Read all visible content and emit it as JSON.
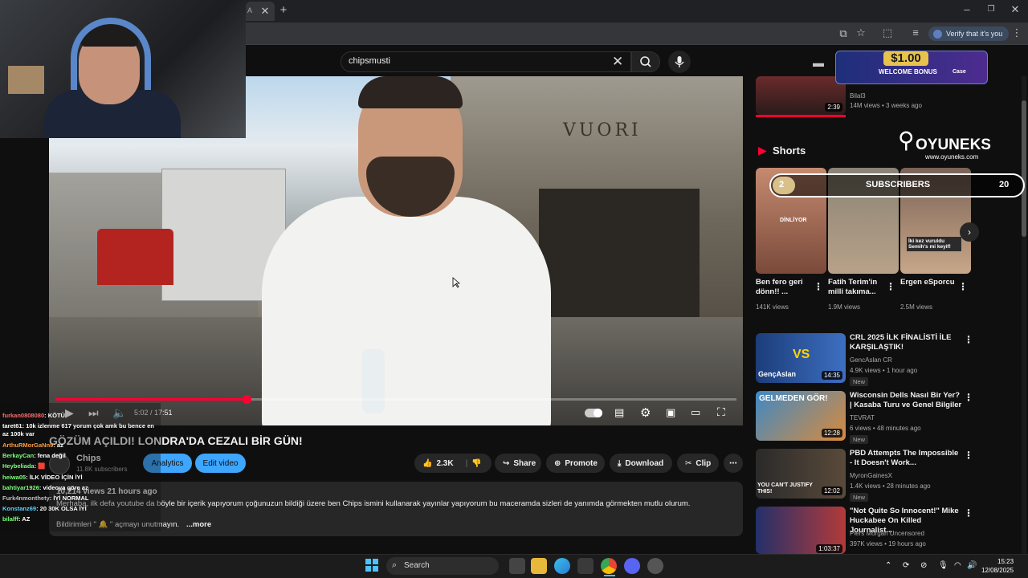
{
  "browser": {
    "tab_partial_title": "A",
    "verify_label": "Verify that it's you"
  },
  "search": {
    "query": "chipsmusti"
  },
  "player": {
    "time_current": "5:02",
    "time_total": "17:51",
    "time_display": "5:02 / 17:51",
    "progress_fraction": 0.281,
    "store_sign": "VUORI"
  },
  "video": {
    "title": "GÖZÜM AÇILDI! LONDRA'DA CEZALI BİR GÜN!",
    "channel_name": "Chips",
    "channel_subs": "11.8K subscribers",
    "analytics_label": "Analytics",
    "edit_label": "Edit video",
    "likes": "2.3K",
    "share_label": "Share",
    "promote_label": "Promote",
    "download_label": "Download",
    "clip_label": "Clip",
    "views_time": "10,214 views  21 hours ago",
    "description": "Merhaba, ilk defa youtube da böyle bir içerik yapıyorum çoğunuzun bildiği üzere ben Chips ismini kullanarak yayınlar yapıyorum bu maceramda sizleri de yanımda görmekten mutlu olurum.",
    "notif_text": "Bildirimleri \" 🔔 \" açmayı unutmayın.",
    "more_label": "...more"
  },
  "chat": [
    {
      "user": "furkan0808080",
      "msg": ": KÖTÜ",
      "color": "#ff6b6b"
    },
    {
      "user": "taret61",
      "msg": ": 10k izlenme 617 yorum çok amk bu bence en az 100k var",
      "color": "#ffffff"
    },
    {
      "user": "ArthuRMorGaNn9",
      "msg": ": az",
      "color": "#ff9a3c"
    },
    {
      "user": "BerkayCan",
      "msg": ": fena değil",
      "color": "#7cff7c"
    },
    {
      "user": "Heybeliada",
      "msg": ": 🟥",
      "color": "#7cff7c"
    },
    {
      "user": "heiwa05",
      "msg": ": İLK VİDEO İÇİN İYİ",
      "color": "#7cff7c"
    },
    {
      "user": "bahtiyar1926",
      "msg": ": videoya göre az",
      "color": "#7cff7c"
    },
    {
      "user": "Furk4nmonthety",
      "msg": ": İYİ NORMAL",
      "color": "#bfbfbf"
    },
    {
      "user": "Konstanz69",
      "msg": ": 20 30K OLSA İYİ",
      "color": "#5fd3ff"
    },
    {
      "user": "bilalff",
      "msg": ": AZ",
      "color": "#7cff7c"
    }
  ],
  "sidebar": {
    "top_video": {
      "channel": "Bilal3",
      "meta": "14M views • 3 weeks ago",
      "duration": "2:39"
    },
    "shorts_heading": "Shorts",
    "shorts": [
      {
        "title": "Ben fero geri dönn!! ...",
        "views": "141K views",
        "overlay": "DİNLİYOR"
      },
      {
        "title": "Fatih Terim'in milli takıma...",
        "views": "1.9M views",
        "overlay": ""
      },
      {
        "title": "Ergen eSporcu",
        "views": "2.5M views",
        "overlay": "İki kez vuruldu Semih's mi keyif!"
      }
    ],
    "videos": [
      {
        "title": "CRL 2025 İLK FİNALİSTİ İLE KARŞILAŞTIK!",
        "channel": "GencAslan CR",
        "meta": "4.9K views • 1 hour ago",
        "badge": "New",
        "duration": "14:35",
        "thumb_text": "GençAslan",
        "thumb_vs": "VS"
      },
      {
        "title": "Wisconsin Dells Nasıl Bir Yer? | Kasaba Turu ve Genel Bilgiler",
        "channel": "TEVRAT",
        "meta": "6 views • 48 minutes ago",
        "badge": "New",
        "duration": "12:28",
        "thumb_text": "GELMEDEN GÖR!"
      },
      {
        "title": "PBD Attempts The Impossible - It Doesn't Work...",
        "channel": "MyronGainesX",
        "meta": "1.4K views • 28 minutes ago",
        "badge": "New",
        "duration": "12:02",
        "thumb_text": "YOU CAN'T JUSTIFY THIS!"
      },
      {
        "title": "\"Not Quite So Innocent!\" Mike Huckabee On Killed Journalist...",
        "channel": "Piers Morgan Uncensored",
        "meta": "397K views • 19 hours ago",
        "badge": "",
        "duration": "1:03:37"
      }
    ]
  },
  "overlays": {
    "bonus_amount": "$1.00",
    "bonus_text": "WELCOME BONUS",
    "bonus_brand": "Case",
    "oyuneks_name": "OYUNEKS",
    "oyuneks_url": "www.oyuneks.com",
    "subs_left": "2",
    "subs_label": "SUBSCRIBERS",
    "subs_right": "20"
  },
  "taskbar": {
    "search_label": "Search",
    "time": "15:23",
    "date": "12/08/2025"
  },
  "colors": {
    "accent_red": "#ff0033",
    "accent_blue": "#3ea6ff"
  }
}
